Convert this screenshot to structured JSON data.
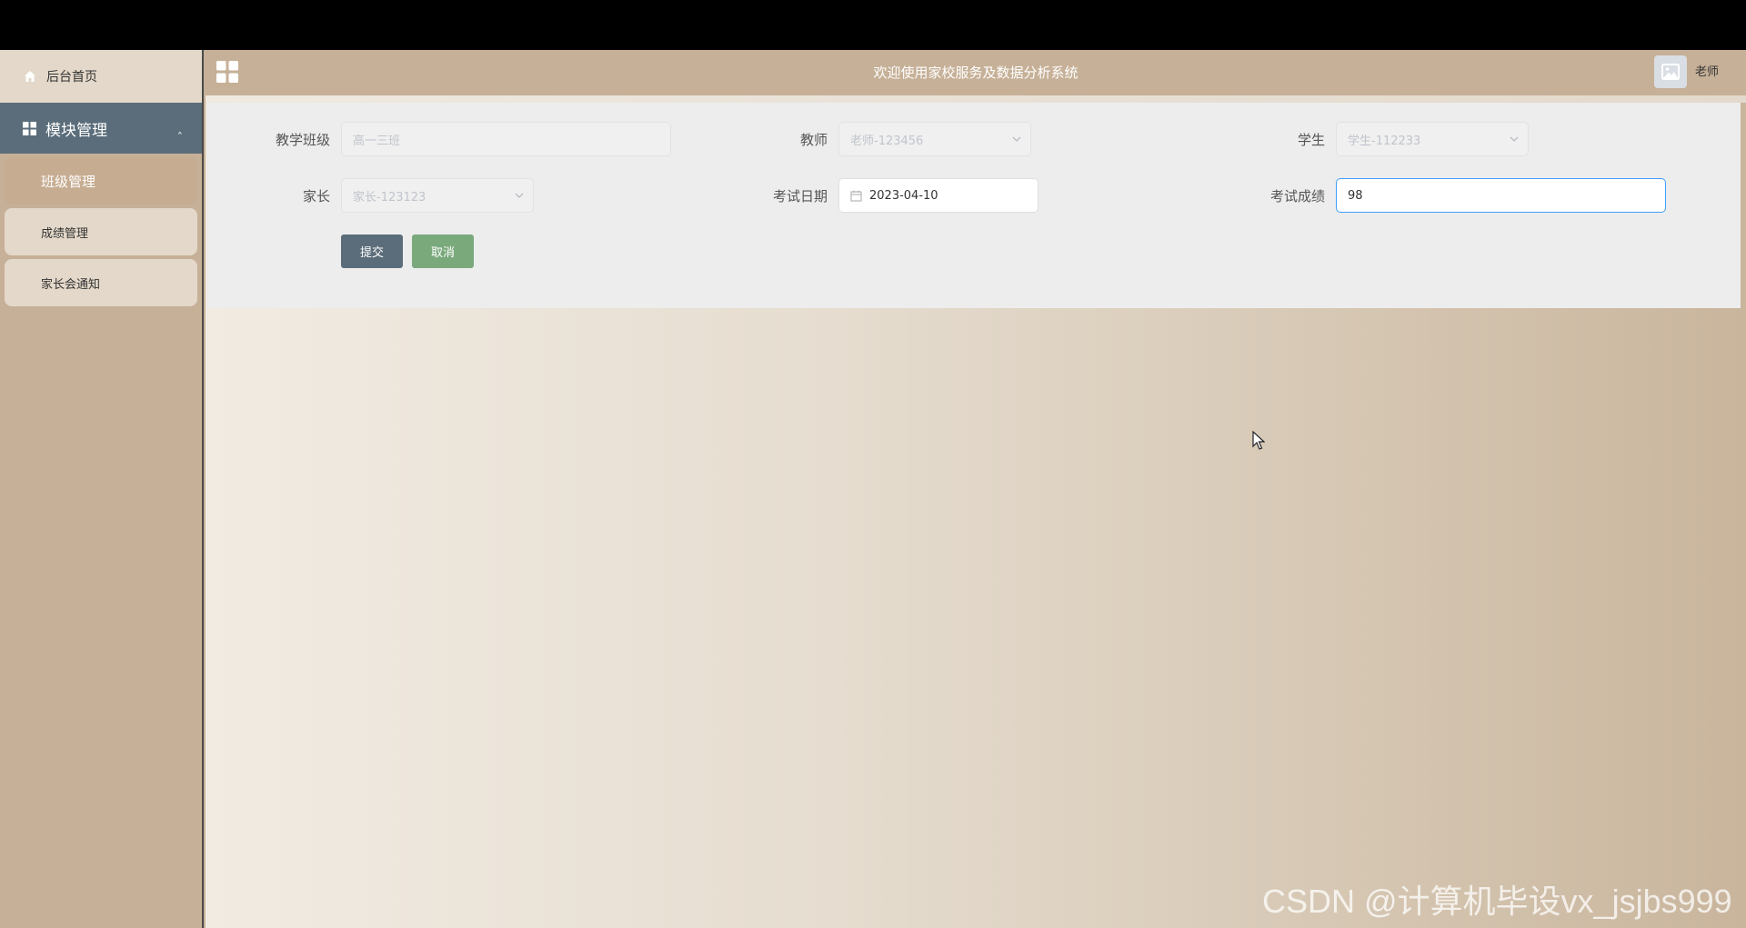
{
  "sidebar": {
    "home_label": "后台首页",
    "module_label": "模块管理",
    "items": [
      {
        "label": "班级管理",
        "active": true
      },
      {
        "label": "成绩管理",
        "active": false
      },
      {
        "label": "家长会通知",
        "active": false
      }
    ]
  },
  "header": {
    "title": "欢迎使用家校服务及数据分析系统",
    "user": "老师"
  },
  "form": {
    "class_label": "教学班级",
    "class_value": "高一三班",
    "teacher_label": "教师",
    "teacher_value": "老师-123456",
    "student_label": "学生",
    "student_value": "学生-112233",
    "parent_label": "家长",
    "parent_value": "家长-123123",
    "exam_date_label": "考试日期",
    "exam_date_value": "2023-04-10",
    "score_label": "考试成绩",
    "score_value": "98",
    "submit_label": "提交",
    "cancel_label": "取消"
  },
  "watermark": "CSDN @计算机毕设vx_jsjbs999"
}
